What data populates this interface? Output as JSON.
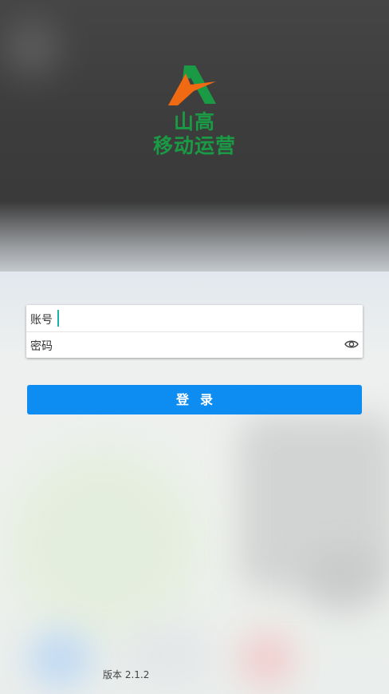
{
  "logo": {
    "line1": "山高",
    "line2": "移动运营",
    "icon": "mountain-a-logo-icon",
    "colors": {
      "green": "#1a9a45",
      "orange": "#ef6a12"
    }
  },
  "form": {
    "account_label": "账号",
    "account_value": "",
    "password_label": "密码",
    "password_value": "",
    "password_toggle_icon": "eye-icon"
  },
  "login_button": {
    "label": "登录",
    "color": "#0d8cf2"
  },
  "footer": {
    "version": "版本 2.1.2"
  }
}
